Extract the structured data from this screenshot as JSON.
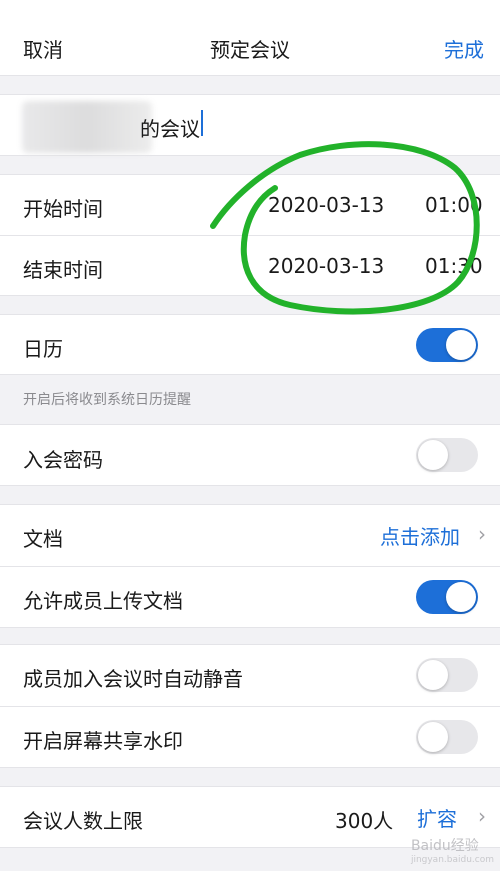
{
  "nav": {
    "cancel": "取消",
    "title": "预定会议",
    "done": "完成"
  },
  "meeting_name": {
    "visible_suffix": "的会议"
  },
  "start_time": {
    "label": "开始时间",
    "date": "2020-03-13",
    "time": "01:00"
  },
  "end_time": {
    "label": "结束时间",
    "date": "2020-03-13",
    "time": "01:30"
  },
  "calendar": {
    "label": "日历",
    "enabled": true,
    "hint": "开启后将收到系统日历提醒"
  },
  "password": {
    "label": "入会密码",
    "enabled": false
  },
  "documents": {
    "label": "文档",
    "action": "点击添加"
  },
  "allow_upload": {
    "label": "允许成员上传文档",
    "enabled": true
  },
  "auto_mute": {
    "label": "成员加入会议时自动静音",
    "enabled": false
  },
  "watermark": {
    "label": "开启屏幕共享水印",
    "enabled": false
  },
  "capacity": {
    "label": "会议人数上限",
    "value": "300人",
    "action": "扩容"
  },
  "site_watermark": {
    "text": "Baidu经验",
    "sub": "jingyan.baidu.com"
  },
  "colors": {
    "accent": "#1d6fd8",
    "annotation": "#22b22a",
    "background": "#f2f2f5"
  }
}
